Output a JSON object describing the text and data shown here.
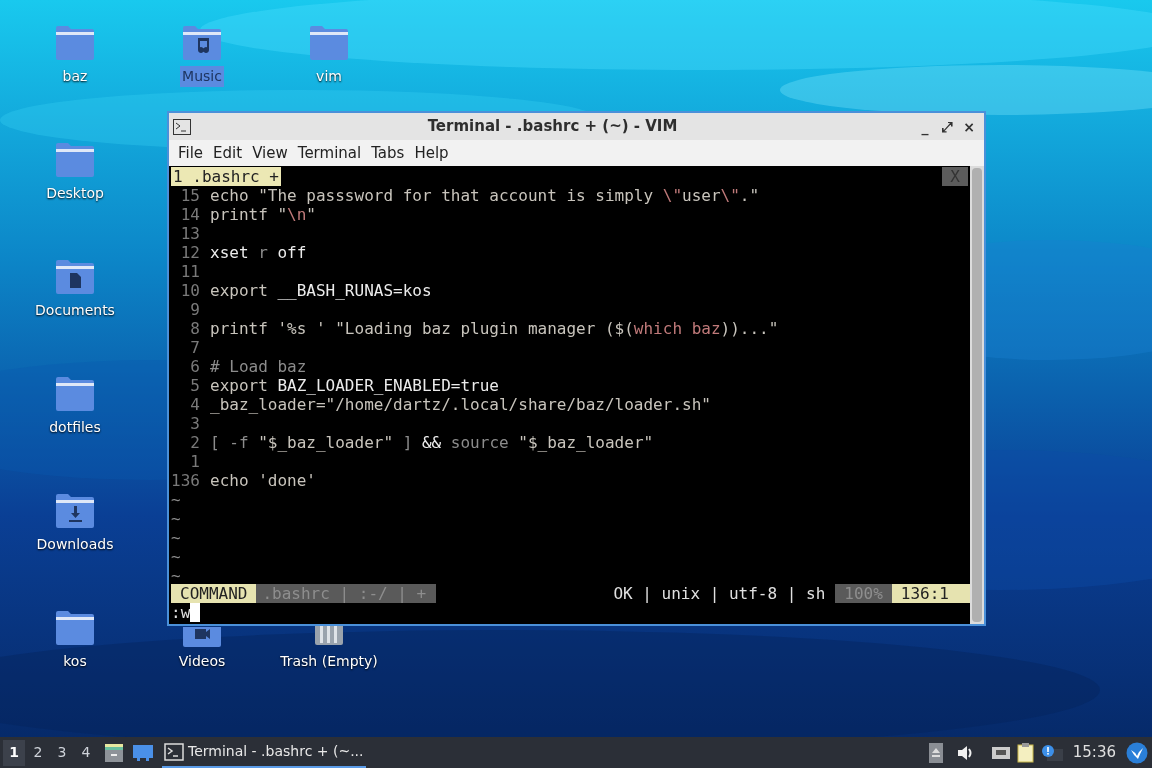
{
  "desktop_icons": [
    {
      "label": "baz",
      "kind": "folder",
      "selected": false
    },
    {
      "label": "Music",
      "kind": "music",
      "selected": true
    },
    {
      "label": "vim",
      "kind": "folder",
      "selected": false
    },
    {
      "label": "Desktop",
      "kind": "folder",
      "selected": false
    },
    {
      "label": "Documents",
      "kind": "documents",
      "selected": false
    },
    {
      "label": "dotfiles",
      "kind": "folder",
      "selected": false
    },
    {
      "label": "Downloads",
      "kind": "downloads",
      "selected": false
    },
    {
      "label": "kos",
      "kind": "folder",
      "selected": false
    },
    {
      "label": "Videos",
      "kind": "videos",
      "selected": false
    },
    {
      "label": "Trash (Empty)",
      "kind": "trash",
      "selected": false
    }
  ],
  "window": {
    "title": "Terminal - .bashrc + (~) - VIM",
    "controls": [
      "_",
      "⤢",
      "×"
    ],
    "menu": [
      "File",
      "Edit",
      "View",
      "Terminal",
      "Tabs",
      "Help"
    ],
    "vim": {
      "tab": "1 .bashrc +",
      "tab_close": "X",
      "lines": [
        {
          "number": "15",
          "tokens": [
            {
              "text": "echo \"The passsword for that account is simply ",
              "kind": "text"
            },
            {
              "text": "\\\"",
              "kind": "special"
            },
            {
              "text": "user",
              "kind": "text"
            },
            {
              "text": "\\\"",
              "kind": "special"
            },
            {
              "text": ".\"",
              "kind": "text"
            }
          ]
        },
        {
          "number": "14",
          "tokens": [
            {
              "text": "printf \"",
              "kind": "text"
            },
            {
              "text": "\\n",
              "kind": "special"
            },
            {
              "text": "\"",
              "kind": "text"
            }
          ]
        },
        {
          "number": "13"
        },
        {
          "number": "12",
          "tokens": [
            {
              "text": "xset ",
              "kind": "bright"
            },
            {
              "text": "r",
              "kind": "dim"
            },
            {
              "text": " off",
              "kind": "bright"
            }
          ]
        },
        {
          "number": "11"
        },
        {
          "number": "10",
          "tokens": [
            {
              "text": "export ",
              "kind": "text"
            },
            {
              "text": "__BASH_RUNAS=kos",
              "kind": "bright"
            }
          ]
        },
        {
          "number": "9"
        },
        {
          "number": "8",
          "tokens": [
            {
              "text": "printf '%s ' \"Loading baz plugin manager ($(",
              "kind": "text"
            },
            {
              "text": "which baz",
              "kind": "special"
            },
            {
              "text": "))...\"",
              "kind": "text"
            }
          ]
        },
        {
          "number": "7"
        },
        {
          "number": "6",
          "tokens": [
            {
              "text": "# Load baz",
              "kind": "dim"
            }
          ]
        },
        {
          "number": "5",
          "tokens": [
            {
              "text": "export ",
              "kind": "text"
            },
            {
              "text": "BAZ_LOADER_ENABLED=true",
              "kind": "bright"
            }
          ]
        },
        {
          "number": "4",
          "tokens": [
            {
              "text": "_baz_loader=\"/home/dartz/.local/share/baz/loader.sh\"",
              "kind": "text"
            }
          ]
        },
        {
          "number": "3"
        },
        {
          "number": "2",
          "tokens": [
            {
              "text": "[ -f ",
              "kind": "dim"
            },
            {
              "text": "\"$_baz_loader\"",
              "kind": "text"
            },
            {
              "text": " ] ",
              "kind": "dim"
            },
            {
              "text": "&& ",
              "kind": "bright"
            },
            {
              "text": "source ",
              "kind": "dim"
            },
            {
              "text": "\"$_baz_loader\"",
              "kind": "text"
            }
          ]
        },
        {
          "number": "1"
        },
        {
          "number": "136",
          "tokens": [
            {
              "text": "echo 'done'",
              "kind": "text"
            }
          ]
        }
      ],
      "tildes": [
        "~",
        "~",
        "~",
        "~",
        "~"
      ],
      "status": {
        "mode": "COMMAND",
        "file": ".bashrc | :-/ | +",
        "info": "OK | unix | utf-8 | sh",
        "percent": "100%",
        "position": "136:1"
      },
      "command": ":w"
    }
  },
  "taskbar": {
    "workspaces": [
      {
        "label": "1",
        "selected": true
      },
      {
        "label": "2",
        "selected": false
      },
      {
        "label": "3",
        "selected": false
      },
      {
        "label": "4",
        "selected": false
      }
    ],
    "task": "Terminal - .bashrc + (~...",
    "clock": "15:36"
  }
}
